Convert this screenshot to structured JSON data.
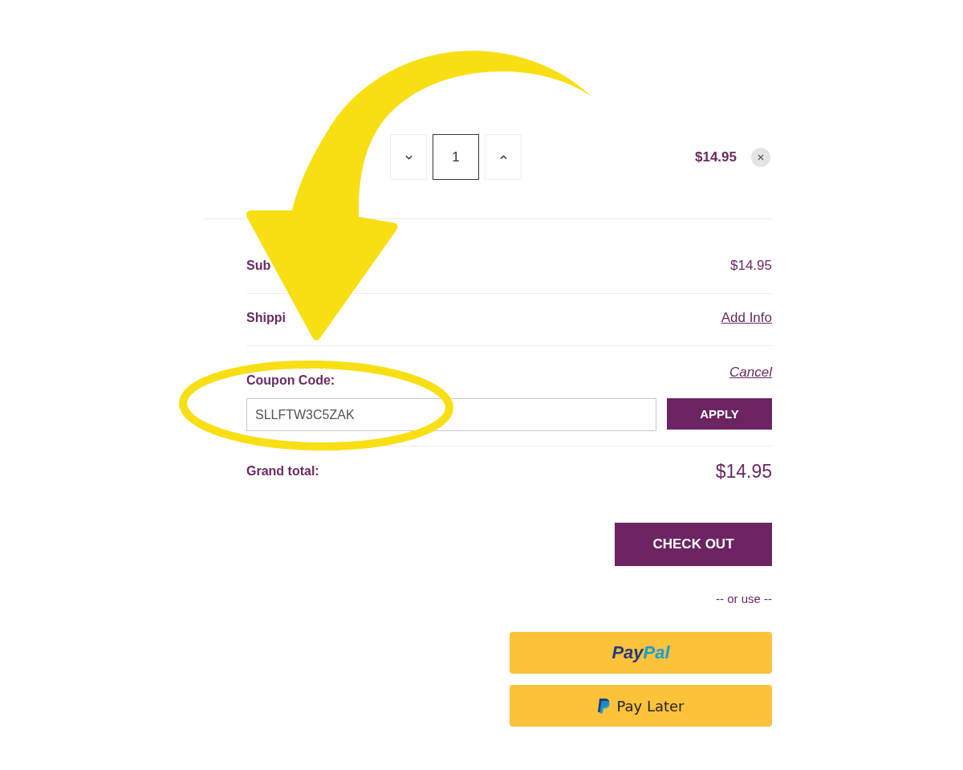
{
  "cart_item": {
    "quantity": "1",
    "price": "$14.95"
  },
  "summary": [
    {
      "kind": "amount",
      "label": "Sub",
      "value": "$14.95"
    },
    {
      "kind": "link",
      "label": "Shippi",
      "value": "Add Info"
    }
  ],
  "coupon": {
    "label": "Coupon Code:",
    "cancel": "Cancel",
    "code": "SLLFTW3C5ZAK",
    "apply": "APPLY"
  },
  "grand_total": {
    "label": "Grand total:",
    "value": "$14.95"
  },
  "checkout": {
    "button": "CHECK OUT",
    "separator": "-- or use --",
    "paypal_logo": [
      "Pay",
      "Pal"
    ],
    "pay_later": "Pay Later"
  }
}
